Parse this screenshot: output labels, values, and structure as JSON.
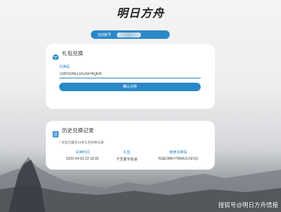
{
  "logo": {
    "text": "明日方舟"
  },
  "account": {
    "label": "当前账号"
  },
  "redeem": {
    "title": "礼包兑换",
    "icon": "gift-box-icon",
    "field_label": "兑换码",
    "code_value": "GWSIX6JJA25P4QEK",
    "confirm_label": "确认兑换"
  },
  "history": {
    "title": "历史兑换记录",
    "icon": "list-icon",
    "note": "* 仅显示最近10条礼包兑换记录",
    "columns": [
      "兑换时间",
      "礼包",
      "使用兑换码"
    ],
    "rows": [
      [
        "2020-04-02 22:16:00",
        "千员寰宇投递",
        "NSEOMKYTAMUCXEVQ"
      ]
    ]
  },
  "watermark": "搜狐号@明日方舟情报",
  "colors": {
    "accent": "#2a88c8"
  }
}
